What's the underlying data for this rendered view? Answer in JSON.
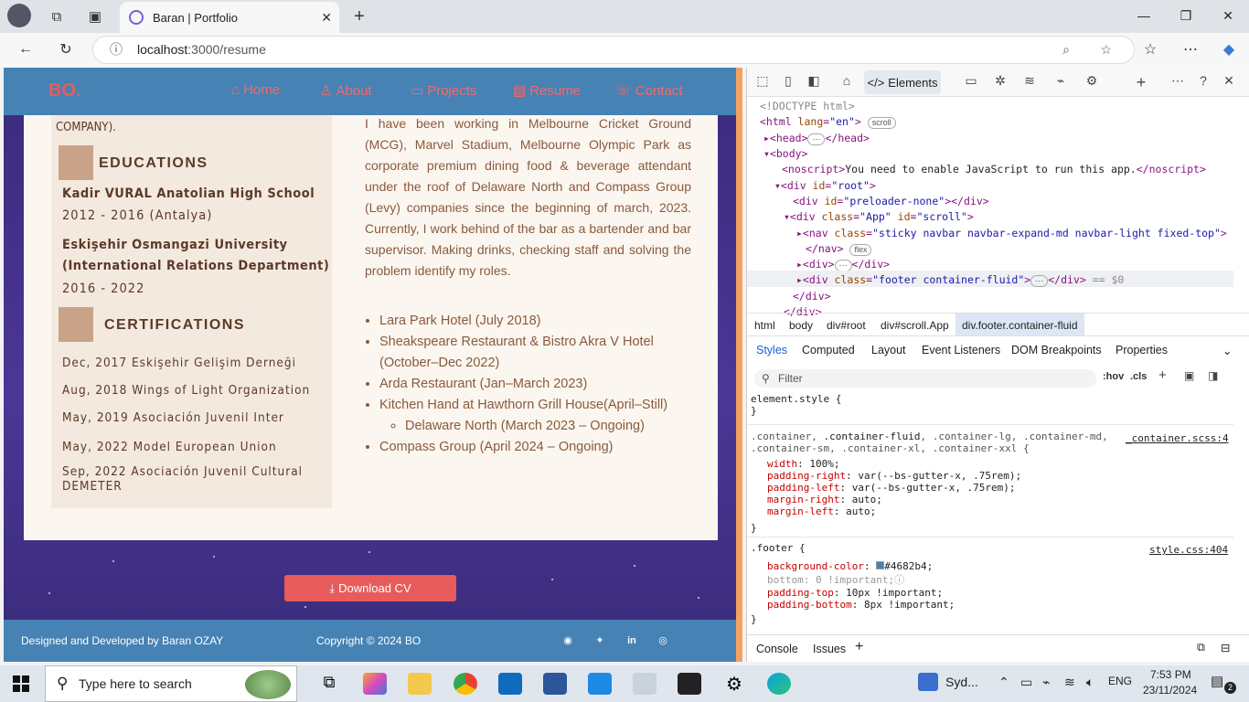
{
  "browser": {
    "tab_title": "Baran | Portfolio",
    "url_host": "localhost",
    "url_path": ":3000/resume"
  },
  "site": {
    "logo": "BO.",
    "nav": [
      "Home",
      "About",
      "Projects",
      "Resume",
      "Contact"
    ],
    "left": {
      "top_fragment": "COMPANY).",
      "educations_heading": "EDUCATIONS",
      "edu1_name": "Kadir VURAL Anatolian High School",
      "edu1_years": "2012 - 2016 (Antalya)",
      "edu2_name_line1": "Eskişehir Osmangazi University",
      "edu2_name_line2": "(International Relations Department)",
      "edu2_years": "2016 - 2022",
      "cert_heading": "CERTIFICATIONS",
      "certs": [
        "Dec, 2017 Eskişehir Gelişim Derneği",
        "Aug, 2018 Wings of Light Organization",
        "May, 2019 Asociación Juvenil Inter",
        "May, 2022 Model European Union",
        "Sep, 2022 Asociación Juvenil Cultural DEMETER"
      ]
    },
    "right": {
      "paragraph": "I have been working in Melbourne Cricket Ground (MCG), Marvel Stadium, Melbourne Olympic Park as corporate premium dining food & beverage attendant under the roof of Delaware North and Compass Group (Levy) companies since the beginning of march, 2023. Currently, I work behind of the bar as a bartender and bar supervisor. Making drinks, checking staff and solving the problem identify my roles.",
      "jobs": [
        "Lara Park Hotel (July 2018)",
        "Sheakspeare Restaurant & Bistro Akra V Hotel (October–Dec 2022)",
        "Arda Restaurant (Jan–March 2023)",
        "Kitchen Hand at Hawthorn Grill House(April–Still)",
        "Compass Group (April 2024 – Ongoing)"
      ],
      "subjob": "Delaware North (March 2023 – Ongoing)"
    },
    "download_label": "Download CV",
    "footer_left": "Designed and Developed by Baran OZAY",
    "footer_mid": "Copyright © 2024 BO"
  },
  "devtools": {
    "elements_tab": "Elements",
    "crumbs": [
      "html",
      "body",
      "div#root",
      "div#scroll.App",
      "div.footer.container-fluid"
    ],
    "subtabs": [
      "Styles",
      "Computed",
      "Layout",
      "Event Listeners",
      "DOM Breakpoints",
      "Properties"
    ],
    "filter_placeholder": "Filter",
    "hov": ":hov",
    "cls": ".cls",
    "source1": "_container.scss:4",
    "source2": "style.css:404",
    "console": "Console",
    "issues": "Issues"
  },
  "taskbar": {
    "search_placeholder": "Type here to search",
    "weather": "Syd...",
    "lang": "ENG",
    "time": "7:53 PM",
    "date": "23/11/2024",
    "notif_count": "2"
  }
}
